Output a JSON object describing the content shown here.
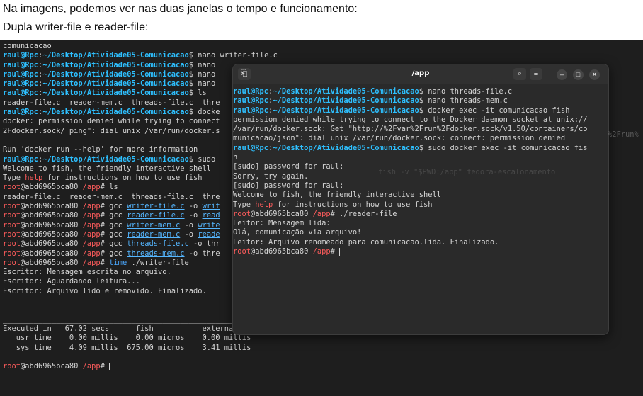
{
  "captions": {
    "line1": "Na imagens, podemos ver nas duas janelas o tempo e funcionamento:",
    "line2": "Dupla writer-file e reader-file:"
  },
  "colors": {
    "background": "#1e1e1e",
    "text": "#d3d3d3",
    "user": "#2ec0ff",
    "root": "#ff5c5c",
    "link": "#55b6ff"
  },
  "back_terminal": {
    "lines": [
      [
        {
          "t": "comunicacao"
        }
      ],
      [
        {
          "t": "raul@Rpc",
          "c": "u"
        },
        {
          "t": ":"
        },
        {
          "t": "~/Desktop/Atividade05-Comunicacao",
          "c": "p"
        },
        {
          "t": "$ nano writer-file.c"
        }
      ],
      [
        {
          "t": "raul@Rpc",
          "c": "u"
        },
        {
          "t": ":"
        },
        {
          "t": "~/Desktop/Atividade05-Comunicacao",
          "c": "p"
        },
        {
          "t": "$ nano"
        }
      ],
      [
        {
          "t": "raul@Rpc",
          "c": "u"
        },
        {
          "t": ":"
        },
        {
          "t": "~/Desktop/Atividade05-Comunicacao",
          "c": "p"
        },
        {
          "t": "$ nano"
        }
      ],
      [
        {
          "t": "raul@Rpc",
          "c": "u"
        },
        {
          "t": ":"
        },
        {
          "t": "~/Desktop/Atividade05-Comunicacao",
          "c": "p"
        },
        {
          "t": "$ nano"
        }
      ],
      [
        {
          "t": "raul@Rpc",
          "c": "u"
        },
        {
          "t": ":"
        },
        {
          "t": "~/Desktop/Atividade05-Comunicacao",
          "c": "p"
        },
        {
          "t": "$ ls"
        }
      ],
      [
        {
          "t": "reader-file.c  reader-mem.c  threads-file.c  thre"
        }
      ],
      [
        {
          "t": "raul@Rpc",
          "c": "u"
        },
        {
          "t": ":"
        },
        {
          "t": "~/Desktop/Atividade05-Comunicacao",
          "c": "p"
        },
        {
          "t": "$ docke"
        }
      ],
      [
        {
          "t": "docker: permission denied while trying to connect"
        }
      ],
      [
        {
          "t": "2Fdocker.sock/_ping\": dial unix /var/run/docker.s"
        }
      ],
      [
        {
          "t": ""
        }
      ],
      [
        {
          "t": "Run 'docker run --help' for more information"
        }
      ],
      [
        {
          "t": "raul@Rpc",
          "c": "u"
        },
        {
          "t": ":"
        },
        {
          "t": "~/Desktop/Atividade05-Comunicacao",
          "c": "p"
        },
        {
          "t": "$ sudo"
        }
      ],
      [
        {
          "t": "Welcome to fish, the friendly interactive shell"
        }
      ],
      [
        {
          "t": "Type "
        },
        {
          "t": "help",
          "c": "r"
        },
        {
          "t": " for instructions on how to use fish"
        }
      ],
      [
        {
          "t": "root",
          "c": "rt"
        },
        {
          "t": "@abd6965bca80 "
        },
        {
          "t": "/app",
          "c": "r"
        },
        {
          "t": "# ls"
        }
      ],
      [
        {
          "t": "reader-file.c  reader-mem.c  threads-file.c  thre"
        }
      ],
      [
        {
          "t": "root",
          "c": "rt"
        },
        {
          "t": "@abd6965bca80 "
        },
        {
          "t": "/app",
          "c": "r"
        },
        {
          "t": "# gcc "
        },
        {
          "t": "writer-file.c",
          "c": "lk"
        },
        {
          "t": " -o "
        },
        {
          "t": "writ",
          "c": "lk"
        }
      ],
      [
        {
          "t": "root",
          "c": "rt"
        },
        {
          "t": "@abd6965bca80 "
        },
        {
          "t": "/app",
          "c": "r"
        },
        {
          "t": "# gcc "
        },
        {
          "t": "reader-file.c",
          "c": "lk"
        },
        {
          "t": " -o "
        },
        {
          "t": "read",
          "c": "lk"
        }
      ],
      [
        {
          "t": "root",
          "c": "rt"
        },
        {
          "t": "@abd6965bca80 "
        },
        {
          "t": "/app",
          "c": "r"
        },
        {
          "t": "# gcc "
        },
        {
          "t": "writer-mem.c",
          "c": "lk"
        },
        {
          "t": " -o "
        },
        {
          "t": "write",
          "c": "lk"
        }
      ],
      [
        {
          "t": "root",
          "c": "rt"
        },
        {
          "t": "@abd6965bca80 "
        },
        {
          "t": "/app",
          "c": "r"
        },
        {
          "t": "# gcc "
        },
        {
          "t": "reader-mem.c",
          "c": "lk"
        },
        {
          "t": " -o "
        },
        {
          "t": "reade",
          "c": "lk"
        }
      ],
      [
        {
          "t": "root",
          "c": "rt"
        },
        {
          "t": "@abd6965bca80 "
        },
        {
          "t": "/app",
          "c": "r"
        },
        {
          "t": "# gcc "
        },
        {
          "t": "threads-file.c",
          "c": "lk"
        },
        {
          "t": " -o thr"
        }
      ],
      [
        {
          "t": "root",
          "c": "rt"
        },
        {
          "t": "@abd6965bca80 "
        },
        {
          "t": "/app",
          "c": "r"
        },
        {
          "t": "# gcc "
        },
        {
          "t": "threads-mem.c",
          "c": "lk"
        },
        {
          "t": " -o thre"
        }
      ],
      [
        {
          "t": "root",
          "c": "rt"
        },
        {
          "t": "@abd6965bca80 "
        },
        {
          "t": "/app",
          "c": "r"
        },
        {
          "t": "# "
        },
        {
          "t": "time",
          "c": "cm"
        },
        {
          "t": " ./writer-file"
        }
      ],
      [
        {
          "t": "Escritor: Mensagem escrita no arquivo."
        }
      ],
      [
        {
          "t": "Escritor: Aguardando leitura..."
        }
      ],
      [
        {
          "t": "Escritor: Arquivo lido e removido. Finalizado."
        }
      ],
      [
        {
          "t": ""
        }
      ],
      [
        {
          "t": ""
        }
      ],
      [
        {
          "t": "________________________________________________________"
        }
      ],
      [
        {
          "t": "Executed in   67.02 secs      fish           external"
        }
      ],
      [
        {
          "t": "   usr time    0.00 millis    0.00 micros    0.00 millis"
        }
      ],
      [
        {
          "t": "   sys time    4.09 millis  675.00 micros    3.41 millis"
        }
      ],
      [
        {
          "t": ""
        }
      ],
      [
        {
          "t": "root",
          "c": "rt"
        },
        {
          "t": "@abd6965bca80 "
        },
        {
          "t": "/app",
          "c": "r"
        },
        {
          "t": "# "
        },
        {
          "cursor": true
        }
      ]
    ]
  },
  "front_window": {
    "title": "/app",
    "ghost_text": "fish -v \"$PWD:/app\" fedora-escalonamento",
    "ghost_side": "%2Frun%",
    "lines": [
      [
        {
          "t": "raul@Rpc",
          "c": "u"
        },
        {
          "t": ":"
        },
        {
          "t": "~/Desktop/Atividade05-Comunicacao",
          "c": "p"
        },
        {
          "t": "$ nano threads-file.c"
        }
      ],
      [
        {
          "t": "raul@Rpc",
          "c": "u"
        },
        {
          "t": ":"
        },
        {
          "t": "~/Desktop/Atividade05-Comunicacao",
          "c": "p"
        },
        {
          "t": "$ nano threads-mem.c"
        }
      ],
      [
        {
          "t": "raul@Rpc",
          "c": "u"
        },
        {
          "t": ":"
        },
        {
          "t": "~/Desktop/Atividade05-Comunicacao",
          "c": "p"
        },
        {
          "t": "$ docker exec -it comunicacao fish"
        }
      ],
      [
        {
          "t": "permission denied while trying to connect to the Docker daemon socket at unix://"
        }
      ],
      [
        {
          "t": "/var/run/docker.sock: Get \"http://%2Fvar%2Frun%2Fdocker.sock/v1.50/containers/co"
        }
      ],
      [
        {
          "t": "municacao/json\": dial unix /var/run/docker.sock: connect: permission denied"
        }
      ],
      [
        {
          "t": "raul@Rpc",
          "c": "u"
        },
        {
          "t": ":"
        },
        {
          "t": "~/Desktop/Atividade05-Comunicacao",
          "c": "p"
        },
        {
          "t": "$ sudo docker exec -it comunicacao fis"
        }
      ],
      [
        {
          "t": "h"
        }
      ],
      [
        {
          "t": "[sudo] password for raul:"
        }
      ],
      [
        {
          "t": "Sorry, try again."
        }
      ],
      [
        {
          "t": "[sudo] password for raul:"
        }
      ],
      [
        {
          "t": "Welcome to fish, the friendly interactive shell"
        }
      ],
      [
        {
          "t": "Type "
        },
        {
          "t": "help",
          "c": "r"
        },
        {
          "t": " for instructions on how to use fish"
        }
      ],
      [
        {
          "t": "root",
          "c": "rt"
        },
        {
          "t": "@abd6965bca80 "
        },
        {
          "t": "/app",
          "c": "r"
        },
        {
          "t": "# ./reader-file"
        }
      ],
      [
        {
          "t": "Leitor: Mensagem lida:"
        }
      ],
      [
        {
          "t": "Olá, comunicação via arquivo!"
        }
      ],
      [
        {
          "t": "Leitor: Arquivo renomeado para comunicacao.lida. Finalizado."
        }
      ],
      [
        {
          "t": "root",
          "c": "rt"
        },
        {
          "t": "@abd6965bca80 "
        },
        {
          "t": "/app",
          "c": "r"
        },
        {
          "t": "# "
        },
        {
          "cursor": true
        }
      ]
    ]
  },
  "icons": {
    "new_tab": "new-tab-icon",
    "search": "search-icon",
    "menu": "hamburger-menu-icon",
    "minimize": "minimize-icon",
    "maximize": "maximize-icon",
    "close": "close-icon"
  }
}
